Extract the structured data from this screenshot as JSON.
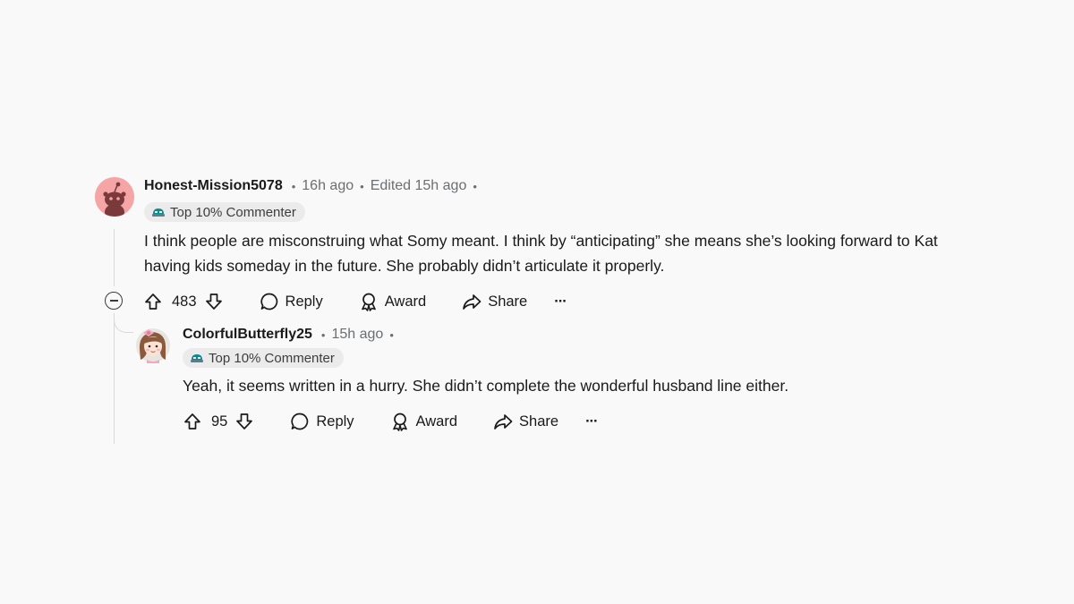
{
  "comments": [
    {
      "username": "Honest-Mission5078",
      "time": "16h ago",
      "edited": "Edited 15h ago",
      "badge": "Top 10% Commenter",
      "text": "I think people are misconstruing what Somy meant. I think by “anticipating” she means she’s looking forward to Kat having kids someday in the future. She probably didn’t articulate it properly.",
      "votes": "483",
      "reply_label": "Reply",
      "award_label": "Award",
      "share_label": "Share",
      "more_label": "···",
      "avatar_color": "#f6a5a7"
    },
    {
      "username": "ColorfulButterfly25",
      "time": "15h ago",
      "badge": "Top 10% Commenter",
      "text": "Yeah, it seems written in a hurry. She didn’t complete the wonderful husband line either.",
      "votes": "95",
      "reply_label": "Reply",
      "award_label": "Award",
      "share_label": "Share",
      "more_label": "···"
    }
  ],
  "icons": {
    "upvote": "arrow-up-icon",
    "downvote": "arrow-down-icon",
    "reply": "speech-bubble-icon",
    "award": "award-icon",
    "share": "share-arrow-icon",
    "collapse": "minus-circle-icon"
  }
}
